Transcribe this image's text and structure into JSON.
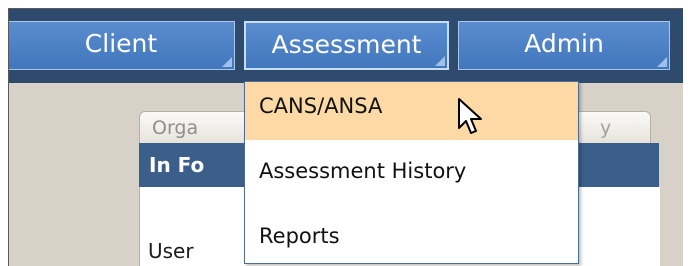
{
  "nav": {
    "client_label": "Client",
    "assessment_label": "Assessment",
    "admin_label": "Admin"
  },
  "dropdown": {
    "items": [
      {
        "label": "CANS/ANSA",
        "highlighted": true
      },
      {
        "label": "Assessment History",
        "highlighted": false
      },
      {
        "label": "Reports",
        "highlighted": false
      }
    ]
  },
  "background": {
    "tab_label_partial": "Orga",
    "tab_label_tail": "y",
    "panel_header_partial": "In Fo",
    "field_label_partial": "User "
  },
  "colors": {
    "navbar_bg": "#2e4a6c",
    "nav_button": "#4a80c6",
    "highlight": "#fcd9a5",
    "panel_header": "#3b5f8a"
  },
  "icons": {
    "cursor": "mouse-pointer-icon",
    "button_corner": "corner-triangle-icon"
  }
}
